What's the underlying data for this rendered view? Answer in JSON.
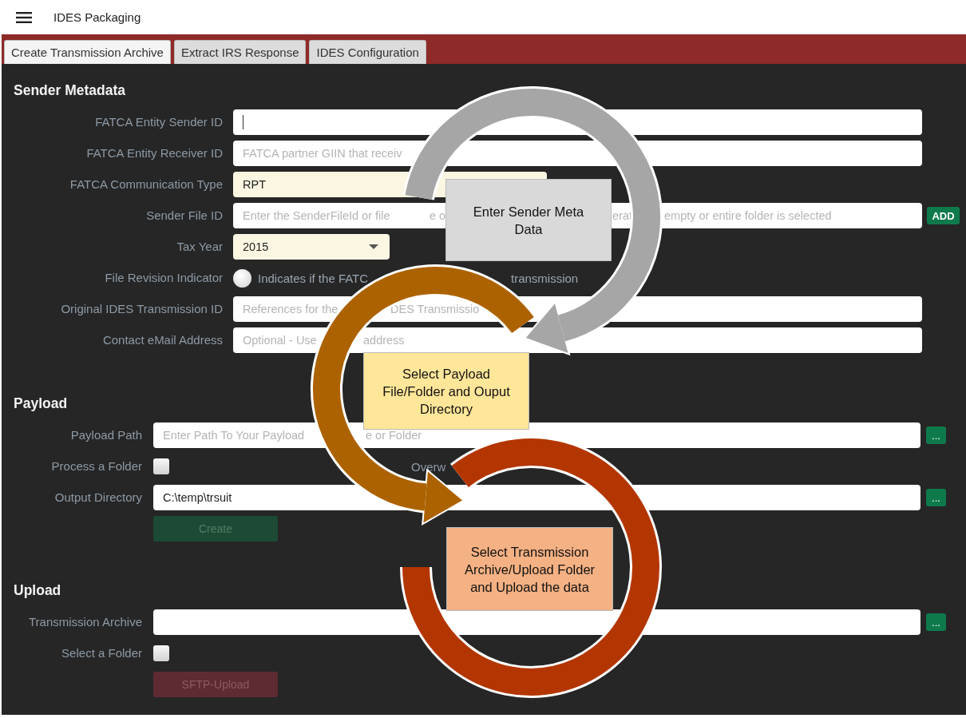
{
  "app": {
    "title": "IDES Packaging"
  },
  "tabs": [
    {
      "label": "Create Transmission Archive",
      "selected": true
    },
    {
      "label": "Extract IRS Response",
      "selected": false
    },
    {
      "label": "IDES Configuration",
      "selected": false
    }
  ],
  "sender_metadata": {
    "heading": "Sender Metadata",
    "fields": [
      {
        "kind": "text",
        "label": "FATCA Entity Sender ID",
        "focused": true
      },
      {
        "kind": "text",
        "label": "FATCA Entity Receiver ID",
        "focused": false,
        "placeholder_parts": [
          "FATCA partner GIIN that receiv"
        ]
      },
      {
        "kind": "choice",
        "label": "FATCA Communication Type",
        "value": "RPT"
      },
      {
        "kind": "text",
        "label": "Sender File ID",
        "focused": false,
        "placeholder_parts": [
          "Enter the SenderFileId or file",
          "e o",
          "erat",
          "empty or entire folder is selected"
        ],
        "button": "ADD"
      },
      {
        "kind": "select",
        "label": "Tax Year",
        "value": "2015"
      },
      {
        "kind": "radio",
        "label": "File Revision Indicator",
        "checked": false,
        "text_parts": [
          "Indicates if the FATC",
          "transmission"
        ]
      },
      {
        "kind": "text",
        "label": "Original IDES Transmission ID",
        "focused": false,
        "placeholder_parts": [
          "References for the",
          "DES Transmissio"
        ]
      },
      {
        "kind": "text",
        "label": "Contact eMail Address",
        "focused": false,
        "placeholder_parts": [
          "Optional - Use",
          "address"
        ]
      }
    ]
  },
  "payload": {
    "heading": "Payload",
    "fields": [
      {
        "kind": "text",
        "label": "Payload Path",
        "focused": false,
        "placeholder_parts": [
          "Enter Path To Your Payload",
          "e or Folder"
        ],
        "button": "..."
      },
      {
        "kind": "checkbox",
        "label": "Process a Folder",
        "checked": false,
        "side_label": "Overw"
      },
      {
        "kind": "text",
        "label": "Output Directory",
        "focused": false,
        "value": "C:\\temp\\trsuit",
        "button": "..."
      },
      {
        "kind": "action",
        "label": "Create",
        "disabled": true
      }
    ]
  },
  "upload": {
    "heading": "Upload",
    "fields": [
      {
        "kind": "text",
        "label": "Transmission Archive",
        "focused": false,
        "button": "..."
      },
      {
        "kind": "checkbox",
        "label": "Select a Folder",
        "checked": false
      },
      {
        "kind": "action",
        "label": "SFTP-Upload",
        "disabled": true
      }
    ]
  },
  "annotations": [
    {
      "text": "Enter Sender Meta Data",
      "color": "#d9d9d9"
    },
    {
      "text": "Select Payload File/Folder and Ouput Directory",
      "color": "#ffe699"
    },
    {
      "text": "Select Transmission Archive/Upload Folder and Upload the data",
      "color": "#f4b183"
    }
  ]
}
